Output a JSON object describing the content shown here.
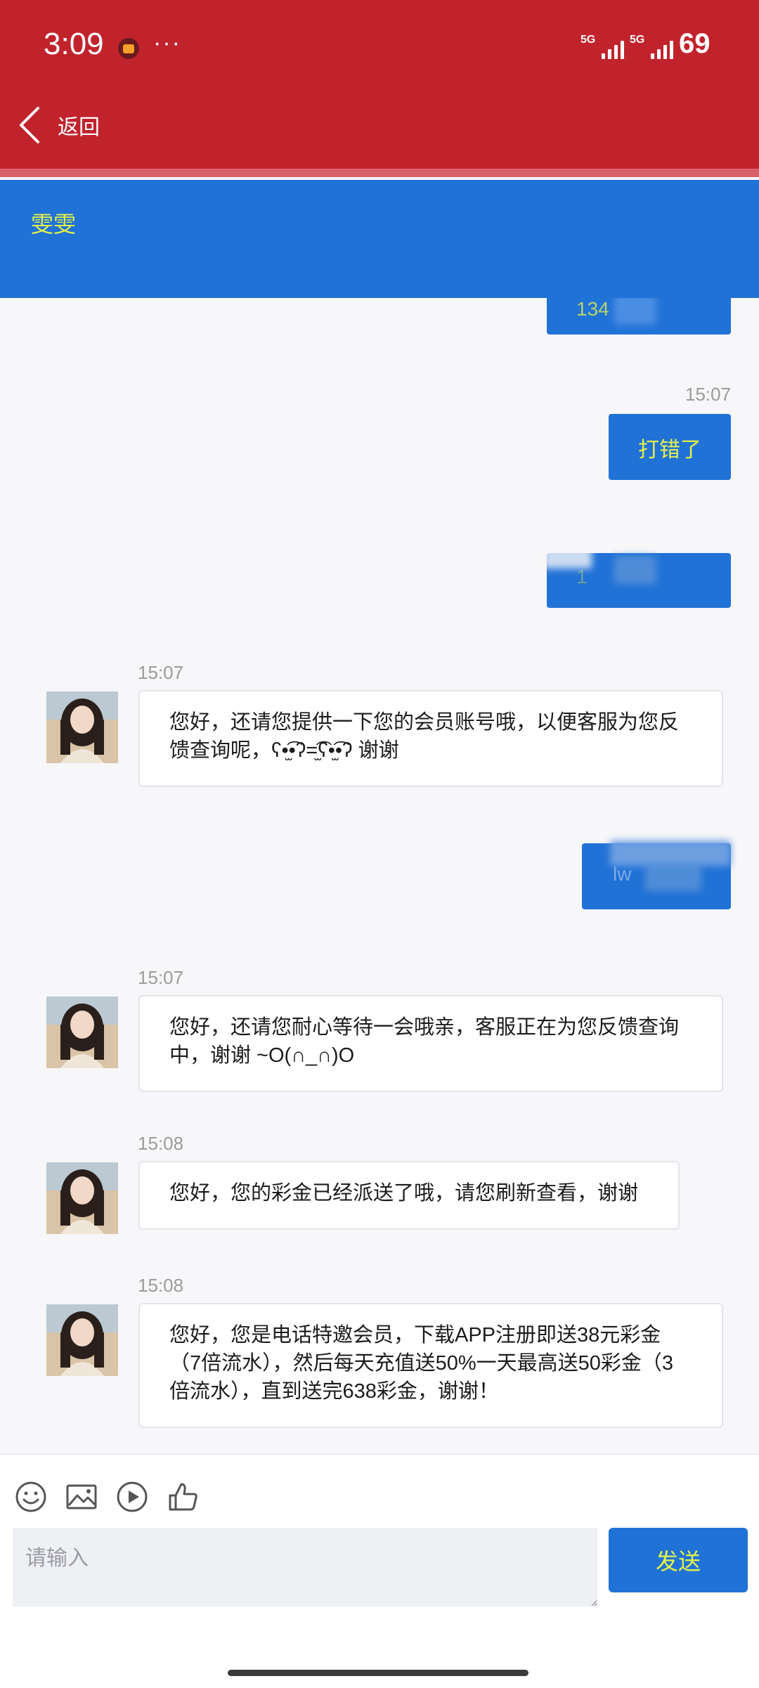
{
  "status_bar": {
    "time": "3:09",
    "more": "···",
    "sim1": "5G",
    "sim2": "5G",
    "battery": "69"
  },
  "header": {
    "back_label": "返回"
  },
  "contact": {
    "name": "雯雯"
  },
  "messages": [
    {
      "side": "out",
      "text": "134",
      "partially_obscured": true
    },
    {
      "side": "out",
      "time": "15:07",
      "text": "打错了"
    },
    {
      "side": "out",
      "text": "1",
      "partially_obscured": true
    },
    {
      "side": "in",
      "time": "15:07",
      "text": "您好，还请您提供一下您的会员账号哦，以便客服为您反馈查询呢，ʕ•̫͡•ʔ=̫͡ʕ•̫͡•ʔ 谢谢"
    },
    {
      "side": "out",
      "text": "lw",
      "partially_obscured": true
    },
    {
      "side": "in",
      "time": "15:07",
      "text": "您好，还请您耐心等待一会哦亲，客服正在为您反馈查询中，谢谢 ~O(∩_∩)O"
    },
    {
      "side": "in",
      "time": "15:08",
      "text": "您好，您的彩金已经派送了哦，请您刷新查看，谢谢"
    },
    {
      "side": "in",
      "time": "15:08",
      "text": "您好，您是电话特邀会员，下载APP注册即送38元彩金（7倍流水），然后每天充值送50%一天最高送50彩金（3倍流水），直到送完638彩金，谢谢！"
    }
  ],
  "composer": {
    "placeholder": "请输入",
    "send_label": "发送",
    "tools": [
      "emoji-icon",
      "image-icon",
      "video-play-icon",
      "thumbs-up-icon"
    ]
  },
  "colors": {
    "header_red": "#c1232d",
    "accent_blue": "#2172d6",
    "accent_yellow_text": "#e4f24a"
  }
}
